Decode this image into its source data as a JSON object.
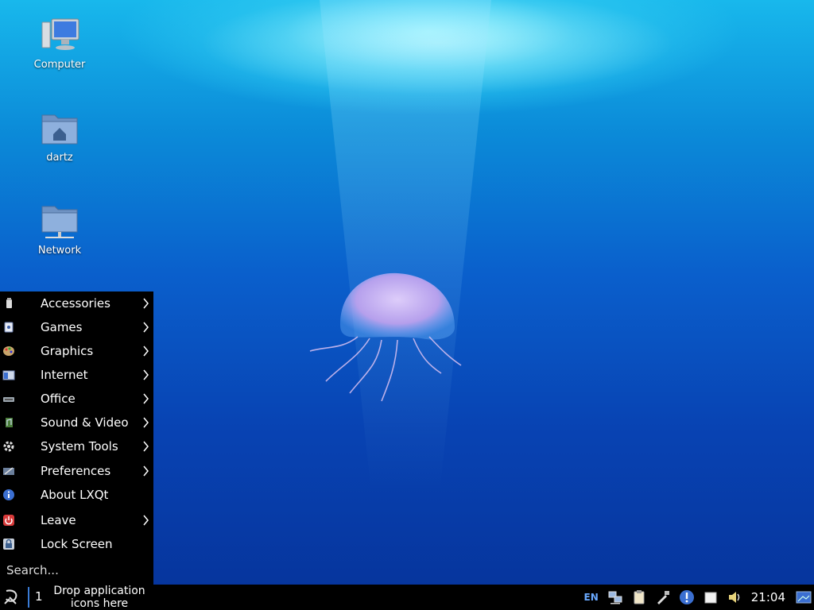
{
  "desktop": {
    "icons": [
      {
        "label": "Computer"
      },
      {
        "label": "dartz"
      },
      {
        "label": "Network"
      }
    ]
  },
  "menu": {
    "items": [
      {
        "label": "Accessories",
        "icon": "accessories-icon",
        "submenu": true
      },
      {
        "label": "Games",
        "icon": "games-icon",
        "submenu": true
      },
      {
        "label": "Graphics",
        "icon": "graphics-icon",
        "submenu": true
      },
      {
        "label": "Internet",
        "icon": "internet-icon",
        "submenu": true
      },
      {
        "label": "Office",
        "icon": "office-icon",
        "submenu": true
      },
      {
        "label": "Sound & Video",
        "icon": "sound-video-icon",
        "submenu": true
      },
      {
        "label": "System Tools",
        "icon": "system-tools-icon",
        "submenu": true
      },
      {
        "label": "Preferences",
        "icon": "preferences-icon",
        "submenu": true
      },
      {
        "label": "About LXQt",
        "icon": "info-icon",
        "submenu": false
      },
      {
        "label": "Leave",
        "icon": "power-icon",
        "submenu": true
      },
      {
        "label": "Lock Screen",
        "icon": "lock-icon",
        "submenu": false
      }
    ],
    "search_placeholder": "Search..."
  },
  "taskbar": {
    "desktop_number": "1",
    "quicklaunch_text": "Drop application icons here",
    "tray": {
      "keyboard_layout": "EN",
      "clock": "21:04"
    }
  },
  "colors": {
    "panel": "#000000",
    "desktop_switcher_accent": "#3a7bd5"
  }
}
